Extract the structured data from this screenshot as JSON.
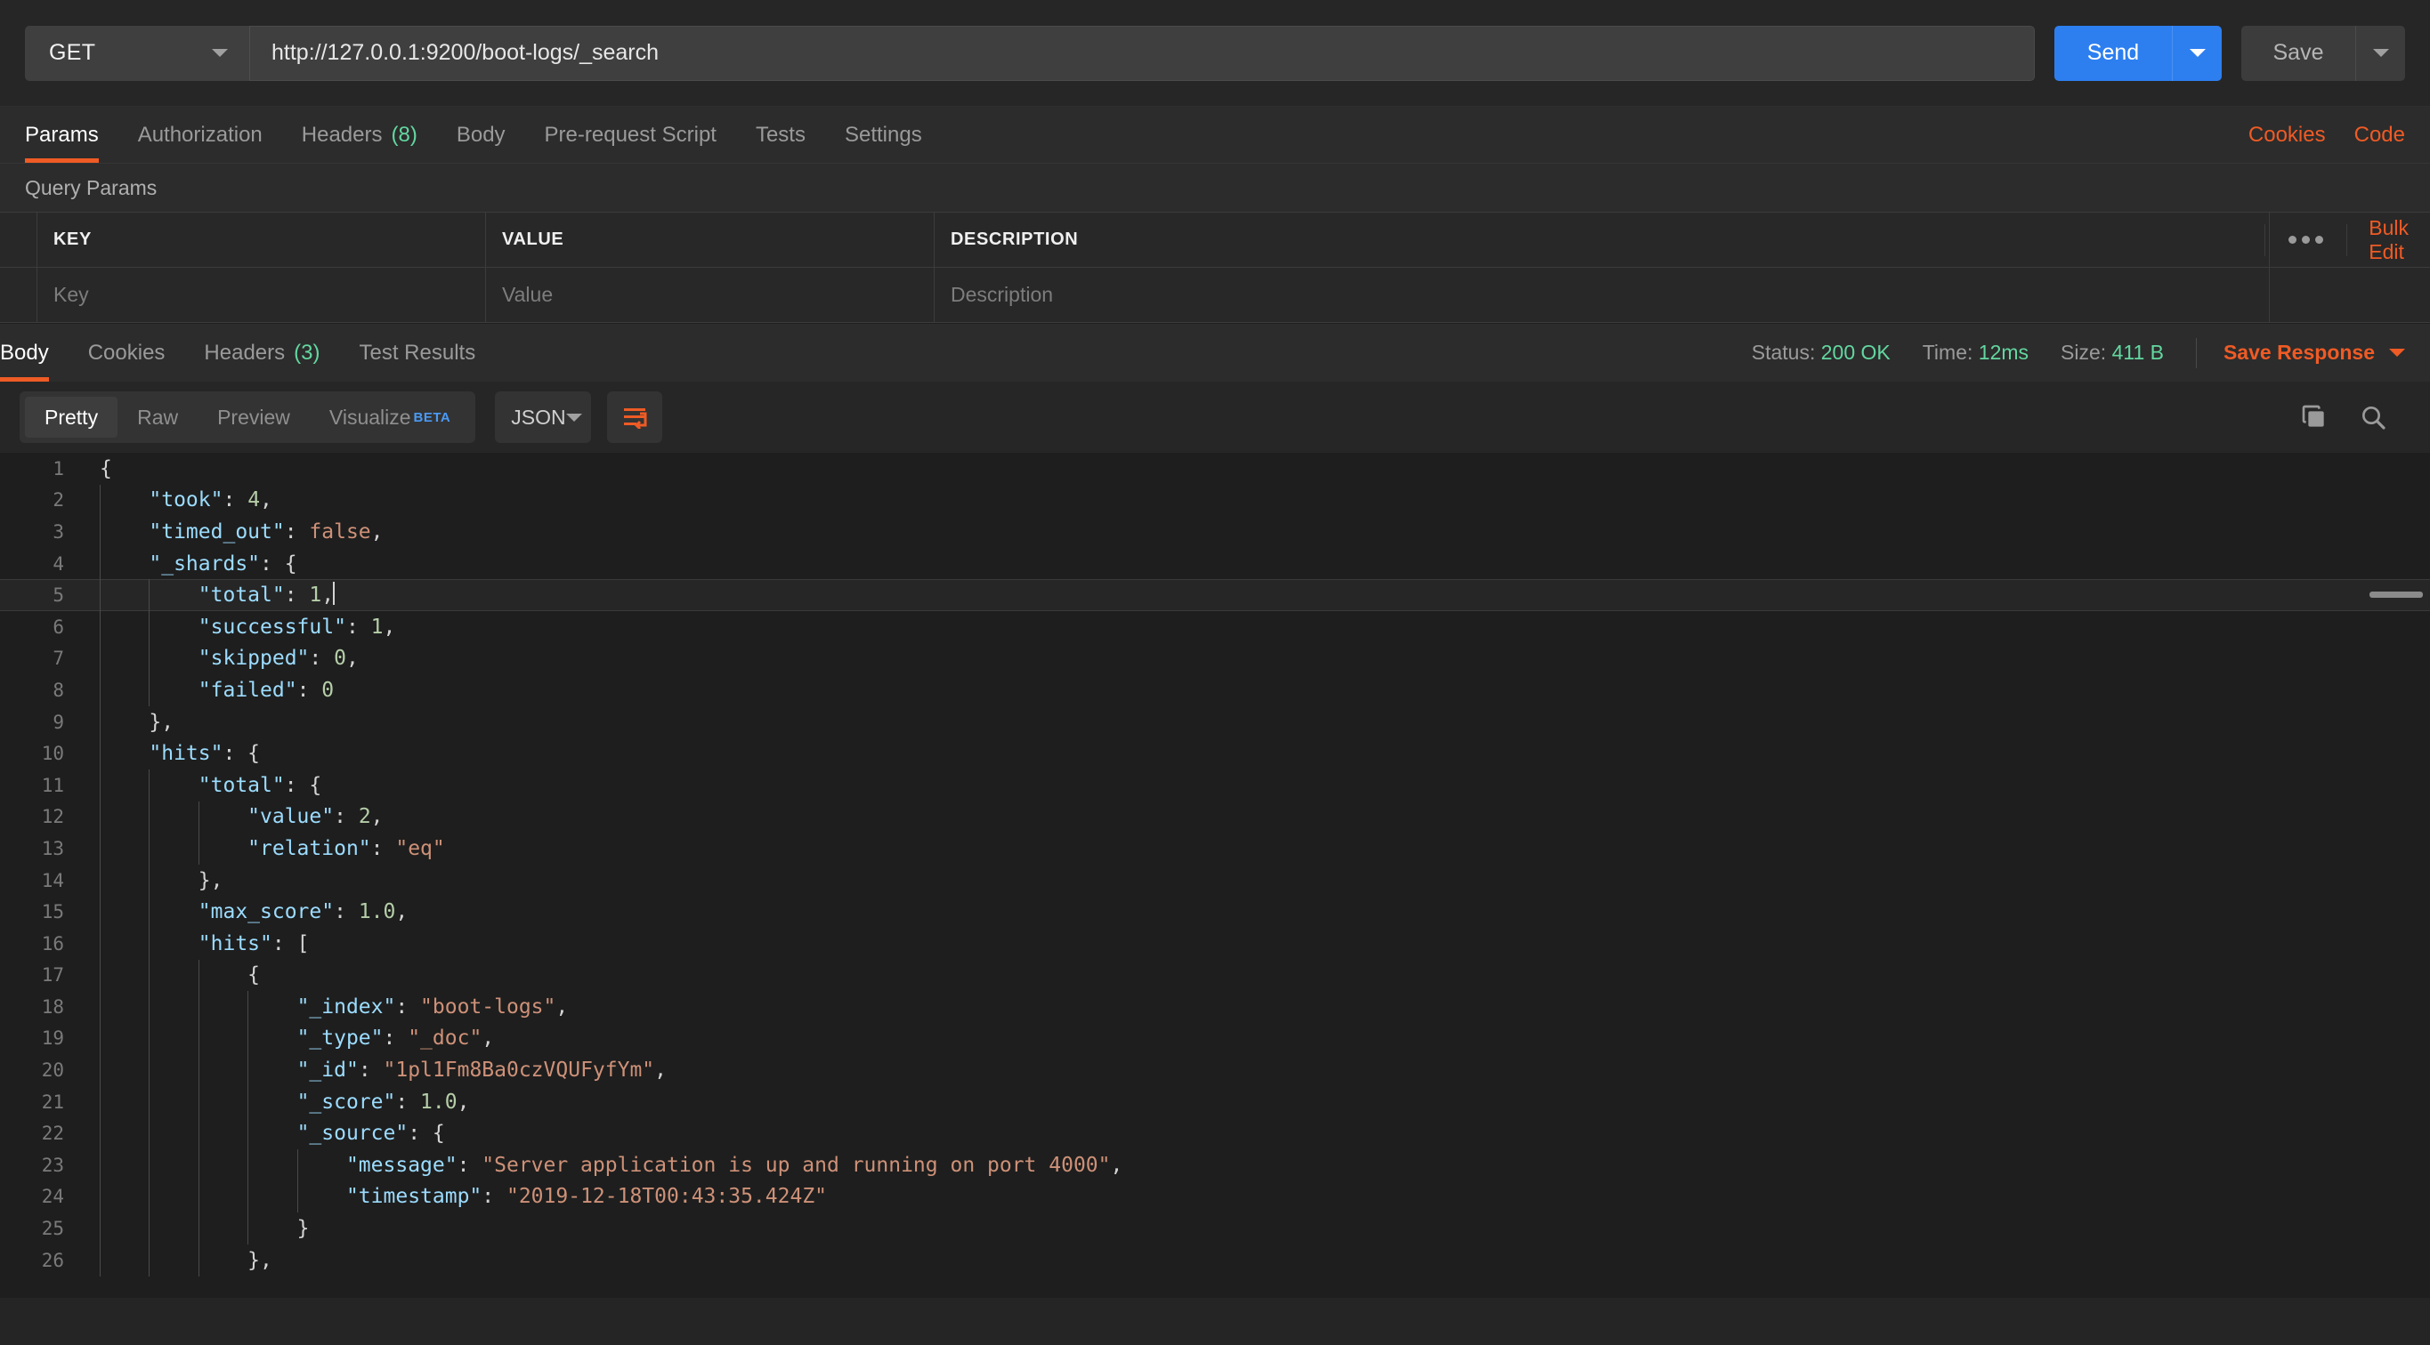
{
  "request": {
    "method": "GET",
    "url": "http://127.0.0.1:9200/boot-logs/_search",
    "send_label": "Send",
    "save_label": "Save"
  },
  "request_tabs": [
    {
      "label": "Params",
      "count": "",
      "active": true
    },
    {
      "label": "Authorization",
      "count": "",
      "active": false
    },
    {
      "label": "Headers",
      "count": "(8)",
      "active": false
    },
    {
      "label": "Body",
      "count": "",
      "active": false
    },
    {
      "label": "Pre-request Script",
      "count": "",
      "active": false
    },
    {
      "label": "Tests",
      "count": "",
      "active": false
    },
    {
      "label": "Settings",
      "count": "",
      "active": false
    }
  ],
  "request_tabs_right": {
    "cookies": "Cookies",
    "code": "Code"
  },
  "query_params": {
    "section_title": "Query Params",
    "columns": [
      "KEY",
      "VALUE",
      "DESCRIPTION"
    ],
    "placeholders": {
      "key": "Key",
      "value": "Value",
      "description": "Description"
    },
    "bulk_edit": "Bulk Edit",
    "more_icon": "ellipsis-icon"
  },
  "response_tabs": [
    {
      "label": "Body",
      "count": "",
      "active": true
    },
    {
      "label": "Cookies",
      "count": "",
      "active": false
    },
    {
      "label": "Headers",
      "count": "(3)",
      "active": false
    },
    {
      "label": "Test Results",
      "count": "",
      "active": false
    }
  ],
  "response_meta": {
    "status_label": "Status:",
    "status_value": "200 OK",
    "time_label": "Time:",
    "time_value": "12ms",
    "size_label": "Size:",
    "size_value": "411 B",
    "save_response": "Save Response"
  },
  "body_toolbar": {
    "views": [
      {
        "label": "Pretty",
        "active": true
      },
      {
        "label": "Raw",
        "active": false
      },
      {
        "label": "Preview",
        "active": false
      },
      {
        "label": "Visualize",
        "active": false,
        "badge": "BETA"
      }
    ],
    "format": "JSON",
    "wrap_icon": "word-wrap-icon",
    "copy_icon": "copy-icon",
    "search_icon": "search-icon"
  },
  "colors": {
    "accent": "#ef5b25",
    "send_blue": "#2d7ff0",
    "status_green": "#63d7a0",
    "beta_blue": "#4a9af5",
    "editor_bg": "#1e1e1e",
    "key_blue": "#9cdcfe",
    "string_salmon": "#ce9178",
    "number_green": "#b5cea8"
  },
  "code": {
    "active_line": 5,
    "lines": [
      {
        "n": 1,
        "indent": 0,
        "tokens": [
          {
            "t": "{",
            "c": "p"
          }
        ]
      },
      {
        "n": 2,
        "indent": 1,
        "tokens": [
          {
            "t": "\"took\"",
            "c": "k"
          },
          {
            "t": ": ",
            "c": "p"
          },
          {
            "t": "4",
            "c": "n"
          },
          {
            "t": ",",
            "c": "p"
          }
        ]
      },
      {
        "n": 3,
        "indent": 1,
        "tokens": [
          {
            "t": "\"timed_out\"",
            "c": "k"
          },
          {
            "t": ": ",
            "c": "p"
          },
          {
            "t": "false",
            "c": "b"
          },
          {
            "t": ",",
            "c": "p"
          }
        ]
      },
      {
        "n": 4,
        "indent": 1,
        "tokens": [
          {
            "t": "\"_shards\"",
            "c": "k"
          },
          {
            "t": ": {",
            "c": "p"
          }
        ]
      },
      {
        "n": 5,
        "indent": 2,
        "tokens": [
          {
            "t": "\"total\"",
            "c": "k"
          },
          {
            "t": ": ",
            "c": "p"
          },
          {
            "t": "1",
            "c": "n"
          },
          {
            "t": ",",
            "c": "p"
          }
        ]
      },
      {
        "n": 6,
        "indent": 2,
        "tokens": [
          {
            "t": "\"successful\"",
            "c": "k"
          },
          {
            "t": ": ",
            "c": "p"
          },
          {
            "t": "1",
            "c": "n"
          },
          {
            "t": ",",
            "c": "p"
          }
        ]
      },
      {
        "n": 7,
        "indent": 2,
        "tokens": [
          {
            "t": "\"skipped\"",
            "c": "k"
          },
          {
            "t": ": ",
            "c": "p"
          },
          {
            "t": "0",
            "c": "n"
          },
          {
            "t": ",",
            "c": "p"
          }
        ]
      },
      {
        "n": 8,
        "indent": 2,
        "tokens": [
          {
            "t": "\"failed\"",
            "c": "k"
          },
          {
            "t": ": ",
            "c": "p"
          },
          {
            "t": "0",
            "c": "n"
          }
        ]
      },
      {
        "n": 9,
        "indent": 1,
        "tokens": [
          {
            "t": "},",
            "c": "p"
          }
        ]
      },
      {
        "n": 10,
        "indent": 1,
        "tokens": [
          {
            "t": "\"hits\"",
            "c": "k"
          },
          {
            "t": ": {",
            "c": "p"
          }
        ]
      },
      {
        "n": 11,
        "indent": 2,
        "tokens": [
          {
            "t": "\"total\"",
            "c": "k"
          },
          {
            "t": ": {",
            "c": "p"
          }
        ]
      },
      {
        "n": 12,
        "indent": 3,
        "tokens": [
          {
            "t": "\"value\"",
            "c": "k"
          },
          {
            "t": ": ",
            "c": "p"
          },
          {
            "t": "2",
            "c": "n"
          },
          {
            "t": ",",
            "c": "p"
          }
        ]
      },
      {
        "n": 13,
        "indent": 3,
        "tokens": [
          {
            "t": "\"relation\"",
            "c": "k"
          },
          {
            "t": ": ",
            "c": "p"
          },
          {
            "t": "\"eq\"",
            "c": "s"
          }
        ]
      },
      {
        "n": 14,
        "indent": 2,
        "tokens": [
          {
            "t": "},",
            "c": "p"
          }
        ]
      },
      {
        "n": 15,
        "indent": 2,
        "tokens": [
          {
            "t": "\"max_score\"",
            "c": "k"
          },
          {
            "t": ": ",
            "c": "p"
          },
          {
            "t": "1.0",
            "c": "n"
          },
          {
            "t": ",",
            "c": "p"
          }
        ]
      },
      {
        "n": 16,
        "indent": 2,
        "tokens": [
          {
            "t": "\"hits\"",
            "c": "k"
          },
          {
            "t": ": [",
            "c": "p"
          }
        ]
      },
      {
        "n": 17,
        "indent": 3,
        "tokens": [
          {
            "t": "{",
            "c": "p"
          }
        ]
      },
      {
        "n": 18,
        "indent": 4,
        "tokens": [
          {
            "t": "\"_index\"",
            "c": "k"
          },
          {
            "t": ": ",
            "c": "p"
          },
          {
            "t": "\"boot-logs\"",
            "c": "s"
          },
          {
            "t": ",",
            "c": "p"
          }
        ]
      },
      {
        "n": 19,
        "indent": 4,
        "tokens": [
          {
            "t": "\"_type\"",
            "c": "k"
          },
          {
            "t": ": ",
            "c": "p"
          },
          {
            "t": "\"_doc\"",
            "c": "s"
          },
          {
            "t": ",",
            "c": "p"
          }
        ]
      },
      {
        "n": 20,
        "indent": 4,
        "tokens": [
          {
            "t": "\"_id\"",
            "c": "k"
          },
          {
            "t": ": ",
            "c": "p"
          },
          {
            "t": "\"1pl1Fm8Ba0czVQUFyfYm\"",
            "c": "s"
          },
          {
            "t": ",",
            "c": "p"
          }
        ]
      },
      {
        "n": 21,
        "indent": 4,
        "tokens": [
          {
            "t": "\"_score\"",
            "c": "k"
          },
          {
            "t": ": ",
            "c": "p"
          },
          {
            "t": "1.0",
            "c": "n"
          },
          {
            "t": ",",
            "c": "p"
          }
        ]
      },
      {
        "n": 22,
        "indent": 4,
        "tokens": [
          {
            "t": "\"_source\"",
            "c": "k"
          },
          {
            "t": ": {",
            "c": "p"
          }
        ]
      },
      {
        "n": 23,
        "indent": 5,
        "tokens": [
          {
            "t": "\"message\"",
            "c": "k"
          },
          {
            "t": ": ",
            "c": "p"
          },
          {
            "t": "\"Server application is up and running on port 4000\"",
            "c": "s"
          },
          {
            "t": ",",
            "c": "p"
          }
        ]
      },
      {
        "n": 24,
        "indent": 5,
        "tokens": [
          {
            "t": "\"timestamp\"",
            "c": "k"
          },
          {
            "t": ": ",
            "c": "p"
          },
          {
            "t": "\"2019-12-18T00:43:35.424Z\"",
            "c": "s"
          }
        ]
      },
      {
        "n": 25,
        "indent": 4,
        "tokens": [
          {
            "t": "}",
            "c": "p"
          }
        ]
      },
      {
        "n": 26,
        "indent": 3,
        "tokens": [
          {
            "t": "},",
            "c": "p"
          }
        ]
      }
    ]
  }
}
